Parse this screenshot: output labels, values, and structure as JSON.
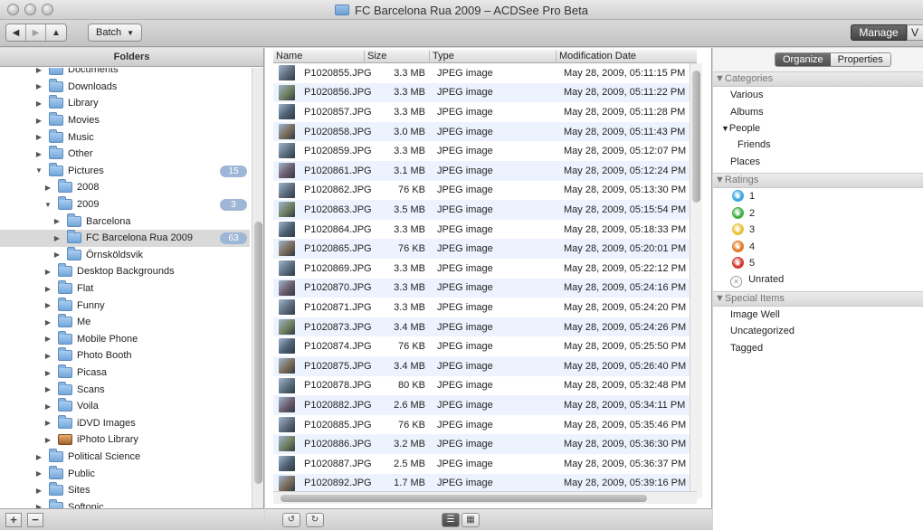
{
  "window": {
    "title": "FC Barcelona Rua 2009 – ACDSee Pro Beta"
  },
  "toolbar": {
    "batch_label": "Batch",
    "manage_label": "Manage",
    "view_label": "V"
  },
  "folders": {
    "header": "Folders",
    "items": [
      {
        "label": "Documents",
        "indent": 0,
        "disclosure": "▶"
      },
      {
        "label": "Downloads",
        "indent": 0,
        "disclosure": "▶"
      },
      {
        "label": "Library",
        "indent": 0,
        "disclosure": "▶"
      },
      {
        "label": "Movies",
        "indent": 0,
        "disclosure": "▶"
      },
      {
        "label": "Music",
        "indent": 0,
        "disclosure": "▶"
      },
      {
        "label": "Other",
        "indent": 0,
        "disclosure": "▶"
      },
      {
        "label": "Pictures",
        "indent": 0,
        "disclosure": "▼",
        "badge": "15"
      },
      {
        "label": "2008",
        "indent": 1,
        "disclosure": "▶"
      },
      {
        "label": "2009",
        "indent": 1,
        "disclosure": "▼",
        "badge": "3"
      },
      {
        "label": "Barcelona",
        "indent": 2,
        "disclosure": "▶"
      },
      {
        "label": "FC Barcelona Rua 2009",
        "indent": 2,
        "disclosure": "▶",
        "badge": "63",
        "selected": true
      },
      {
        "label": "Örnsköldsvik",
        "indent": 2,
        "disclosure": "▶"
      },
      {
        "label": "Desktop Backgrounds",
        "indent": 1,
        "disclosure": "▶"
      },
      {
        "label": "Flat",
        "indent": 1,
        "disclosure": "▶"
      },
      {
        "label": "Funny",
        "indent": 1,
        "disclosure": "▶"
      },
      {
        "label": "Me",
        "indent": 1,
        "disclosure": "▶"
      },
      {
        "label": "Mobile Phone",
        "indent": 1,
        "disclosure": "▶"
      },
      {
        "label": "Photo Booth",
        "indent": 1,
        "disclosure": "▶"
      },
      {
        "label": "Picasa",
        "indent": 1,
        "disclosure": "▶"
      },
      {
        "label": "Scans",
        "indent": 1,
        "disclosure": "▶"
      },
      {
        "label": "Voila",
        "indent": 1,
        "disclosure": "▶"
      },
      {
        "label": "iDVD Images",
        "indent": 1,
        "disclosure": "▶"
      },
      {
        "label": "iPhoto Library",
        "indent": 1,
        "disclosure": "▶",
        "icon": "iphoto"
      },
      {
        "label": "Political Science",
        "indent": 0,
        "disclosure": "▶"
      },
      {
        "label": "Public",
        "indent": 0,
        "disclosure": "▶"
      },
      {
        "label": "Sites",
        "indent": 0,
        "disclosure": "▶"
      },
      {
        "label": "Softonic",
        "indent": 0,
        "disclosure": "▶"
      }
    ],
    "add_label": "+",
    "remove_label": "−"
  },
  "files": {
    "columns": {
      "name": "Name",
      "size": "Size",
      "type": "Type",
      "date": "Modification Date"
    },
    "rows": [
      {
        "name": "P1020855.JPG",
        "size": "3.3 MB",
        "type": "JPEG image",
        "date": "May 28, 2009, 05:11:15 PM"
      },
      {
        "name": "P1020856.JPG",
        "size": "3.3 MB",
        "type": "JPEG image",
        "date": "May 28, 2009, 05:11:22 PM"
      },
      {
        "name": "P1020857.JPG",
        "size": "3.3 MB",
        "type": "JPEG image",
        "date": "May 28, 2009, 05:11:28 PM"
      },
      {
        "name": "P1020858.JPG",
        "size": "3.0 MB",
        "type": "JPEG image",
        "date": "May 28, 2009, 05:11:43 PM"
      },
      {
        "name": "P1020859.JPG",
        "size": "3.3 MB",
        "type": "JPEG image",
        "date": "May 28, 2009, 05:12:07 PM"
      },
      {
        "name": "P1020861.JPG",
        "size": "3.1 MB",
        "type": "JPEG image",
        "date": "May 28, 2009, 05:12:24 PM"
      },
      {
        "name": "P1020862.JPG",
        "size": "76 KB",
        "type": "JPEG image",
        "date": "May 28, 2009, 05:13:30 PM"
      },
      {
        "name": "P1020863.JPG",
        "size": "3.5 MB",
        "type": "JPEG image",
        "date": "May 28, 2009, 05:15:54 PM"
      },
      {
        "name": "P1020864.JPG",
        "size": "3.3 MB",
        "type": "JPEG image",
        "date": "May 28, 2009, 05:18:33 PM"
      },
      {
        "name": "P1020865.JPG",
        "size": "76 KB",
        "type": "JPEG image",
        "date": "May 28, 2009, 05:20:01 PM"
      },
      {
        "name": "P1020869.JPG",
        "size": "3.3 MB",
        "type": "JPEG image",
        "date": "May 28, 2009, 05:22:12 PM"
      },
      {
        "name": "P1020870.JPG",
        "size": "3.3 MB",
        "type": "JPEG image",
        "date": "May 28, 2009, 05:24:16 PM"
      },
      {
        "name": "P1020871.JPG",
        "size": "3.3 MB",
        "type": "JPEG image",
        "date": "May 28, 2009, 05:24:20 PM"
      },
      {
        "name": "P1020873.JPG",
        "size": "3.4 MB",
        "type": "JPEG image",
        "date": "May 28, 2009, 05:24:26 PM"
      },
      {
        "name": "P1020874.JPG",
        "size": "76 KB",
        "type": "JPEG image",
        "date": "May 28, 2009, 05:25:50 PM"
      },
      {
        "name": "P1020875.JPG",
        "size": "3.4 MB",
        "type": "JPEG image",
        "date": "May 28, 2009, 05:26:40 PM"
      },
      {
        "name": "P1020878.JPG",
        "size": "80 KB",
        "type": "JPEG image",
        "date": "May 28, 2009, 05:32:48 PM"
      },
      {
        "name": "P1020882.JPG",
        "size": "2.6 MB",
        "type": "JPEG image",
        "date": "May 28, 2009, 05:34:11 PM"
      },
      {
        "name": "P1020885.JPG",
        "size": "76 KB",
        "type": "JPEG image",
        "date": "May 28, 2009, 05:35:46 PM"
      },
      {
        "name": "P1020886.JPG",
        "size": "3.2 MB",
        "type": "JPEG image",
        "date": "May 28, 2009, 05:36:30 PM"
      },
      {
        "name": "P1020887.JPG",
        "size": "2.5 MB",
        "type": "JPEG image",
        "date": "May 28, 2009, 05:36:37 PM"
      },
      {
        "name": "P1020892.JPG",
        "size": "1.7 MB",
        "type": "JPEG image",
        "date": "May 28, 2009, 05:39:16 PM"
      }
    ]
  },
  "organize": {
    "tabs": [
      "Organize",
      "Properties"
    ],
    "active_tab": "Organize",
    "categories": {
      "header": "Categories",
      "items": [
        "Various",
        "Albums",
        "People",
        "Friends",
        "Places"
      ]
    },
    "ratings": {
      "header": "Ratings",
      "items": [
        {
          "label": "1",
          "color": "#3ea6e0"
        },
        {
          "label": "2",
          "color": "#3fb045"
        },
        {
          "label": "3",
          "color": "#e6c23a"
        },
        {
          "label": "4",
          "color": "#e07a2a"
        },
        {
          "label": "5",
          "color": "#d23a2e"
        }
      ],
      "unrated": "Unrated"
    },
    "special": {
      "header": "Special Items",
      "items": [
        "Image Well",
        "Uncategorized",
        "Tagged"
      ]
    }
  }
}
